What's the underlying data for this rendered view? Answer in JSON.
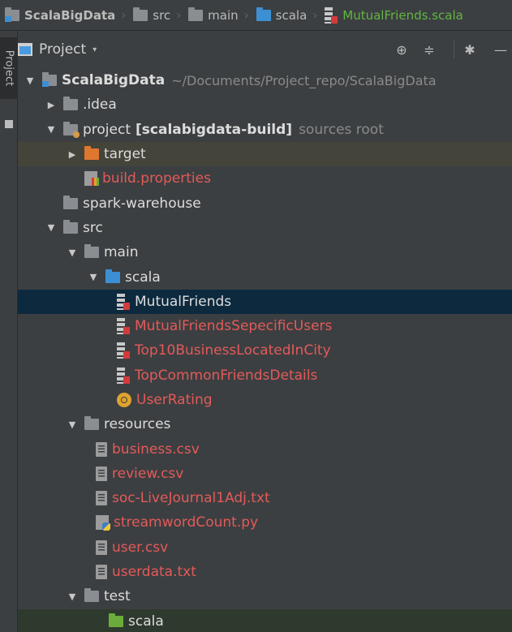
{
  "breadcrumb": {
    "project": "ScalaBigData",
    "src": "src",
    "main": "main",
    "scala": "scala",
    "file": "MutualFriends.scala"
  },
  "toolstrip": {
    "label": "Project"
  },
  "header": {
    "title": "Project",
    "caret": "▾",
    "locate_icon": "⊕",
    "collapse_icon": "≑",
    "settings_icon": "✱",
    "hide_icon": "—"
  },
  "tree": {
    "root": {
      "label": "ScalaBigData",
      "path": "~/Documents/Project_repo/ScalaBigData"
    },
    "idea": {
      "label": ".idea"
    },
    "project": {
      "label": "project",
      "extra_bold": "[scalabigdata-build]",
      "extra_gray": "sources root"
    },
    "target": {
      "label": "target"
    },
    "build_properties": {
      "label": "build.properties"
    },
    "spark_warehouse": {
      "label": "spark-warehouse"
    },
    "src": {
      "label": "src"
    },
    "main": {
      "label": "main"
    },
    "scala": {
      "label": "scala"
    },
    "mutual_friends": {
      "label": "MutualFriends"
    },
    "mutual_specific": {
      "label": "MutualFriendsSepecificUsers"
    },
    "top10": {
      "label": "Top10BusinessLocatedInCity"
    },
    "top_common": {
      "label": "TopCommonFriendsDetails"
    },
    "user_rating": {
      "label": "UserRating"
    },
    "resources": {
      "label": "resources"
    },
    "business_csv": {
      "label": "business.csv"
    },
    "review_csv": {
      "label": "review.csv"
    },
    "soc_live": {
      "label": "soc-LiveJournal1Adj.txt"
    },
    "stream_py": {
      "label": "streamwordCount.py"
    },
    "user_csv": {
      "label": "user.csv"
    },
    "userdata_txt": {
      "label": "userdata.txt"
    },
    "test": {
      "label": "test"
    },
    "test_scala": {
      "label": "scala"
    }
  },
  "colors": {
    "background": "#3c3f41",
    "selection": "#0d293e",
    "modified_red": "#e35a5a",
    "breadcrumb_file_green": "#62b543"
  }
}
